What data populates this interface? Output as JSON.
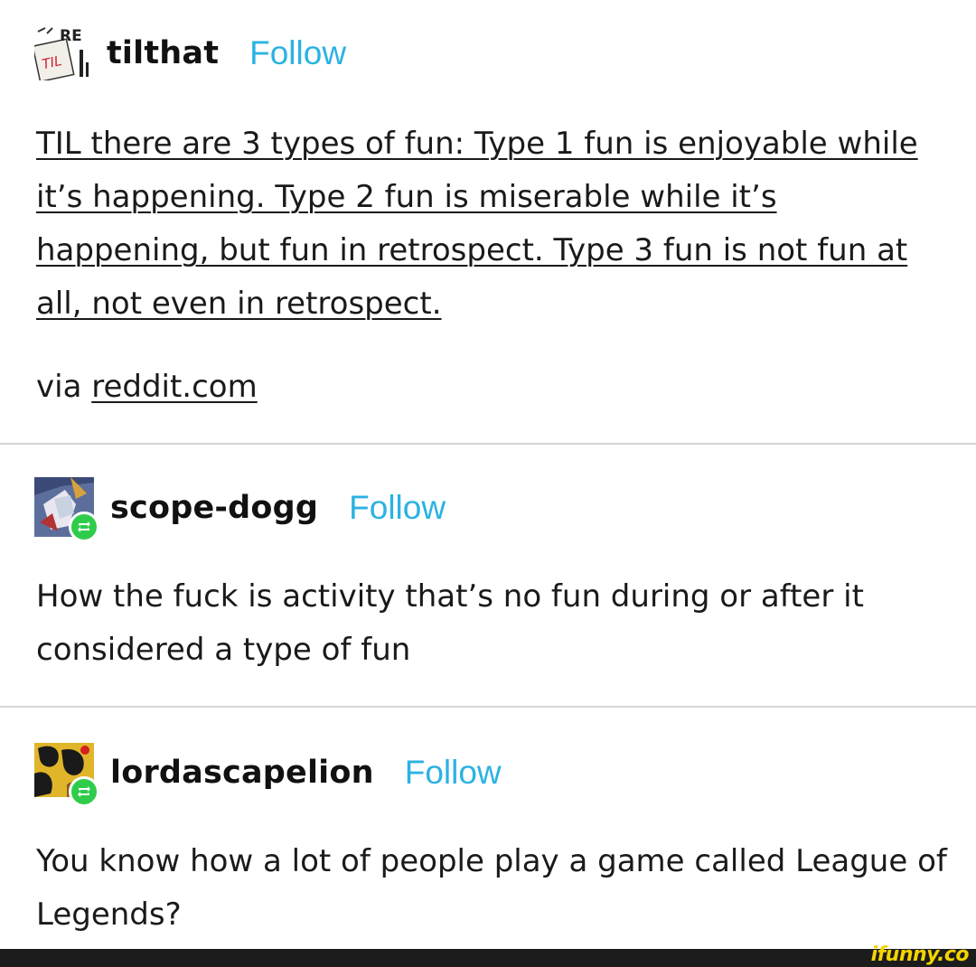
{
  "posts": [
    {
      "username": "tilthat",
      "follow_label": "Follow",
      "text": "TIL there are 3 types of fun: Type 1 fun is enjoyable while it’s happening. Type 2 fun is miserable while it’s happening, but fun in retrospect. Type 3 fun is not fun at all, not even in retrospect.",
      "via_prefix": "via",
      "via_link": "reddit.com",
      "avatar_text": "TIL",
      "avatar_text_top": "RE"
    },
    {
      "username": "scope-dogg",
      "follow_label": "Follow",
      "text": "How the fuck is activity that’s no fun during or after it considered a type of fun"
    },
    {
      "username": "lordascapelion",
      "follow_label": "Follow",
      "text": "You know how a lot of people play a game called League of Legends?"
    }
  ],
  "watermark": "ifunny.co",
  "colors": {
    "follow": "#2bb2e3",
    "reblog_badge": "#2fcc4b",
    "divider": "#d6d6d6",
    "watermark": "#f5d400",
    "footer": "#1c1c1c"
  },
  "icons": [
    "reblog-icon"
  ]
}
